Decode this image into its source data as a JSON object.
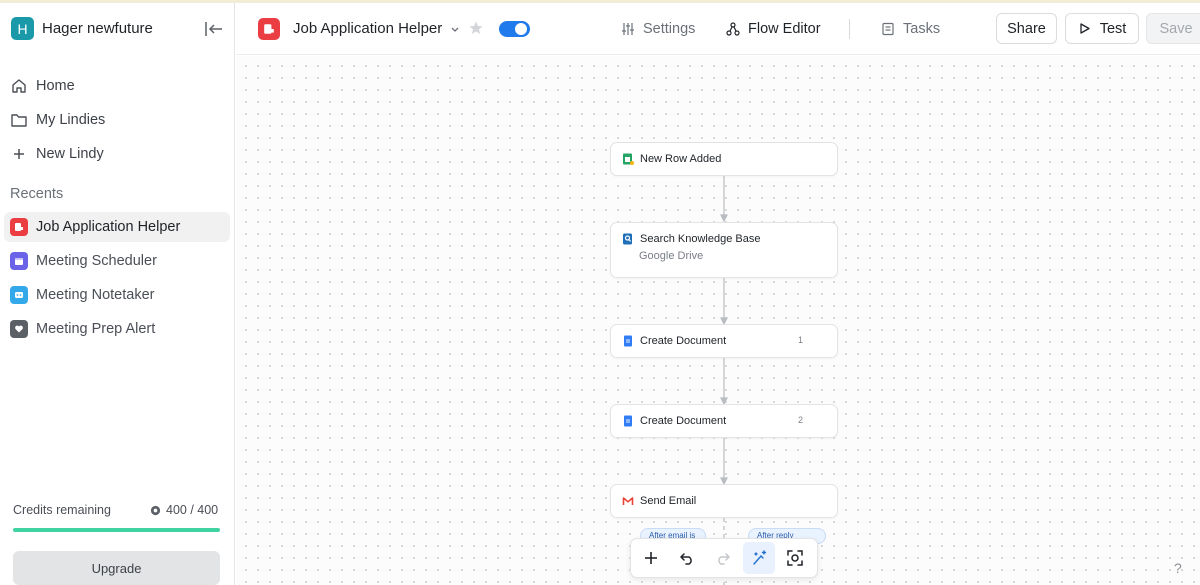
{
  "workspace": {
    "initial": "H",
    "name": "Hager newfuture"
  },
  "nav": [
    {
      "label": "Home",
      "icon": "home-icon"
    },
    {
      "label": "My Lindies",
      "icon": "folder-icon"
    },
    {
      "label": "New Lindy",
      "icon": "plus-icon"
    }
  ],
  "recents": {
    "title": "Recents",
    "items": [
      {
        "label": "Job Application Helper",
        "color": "#ea3e43",
        "active": true
      },
      {
        "label": "Meeting Scheduler",
        "color": "#6a63e8",
        "active": false
      },
      {
        "label": "Meeting Notetaker",
        "color": "#33a9ea",
        "active": false
      },
      {
        "label": "Meeting Prep Alert",
        "color": "#5b5f66",
        "active": false
      }
    ]
  },
  "credits": {
    "label": "Credits remaining",
    "value": "400 / 400",
    "fraction": 1.0,
    "color": "#3fd3a2"
  },
  "upgrade_label": "Upgrade",
  "header": {
    "title": "Job Application Helper",
    "toggle_on": true,
    "tabs": [
      {
        "label": "Settings",
        "icon": "sliders-icon",
        "selected": false
      },
      {
        "label": "Flow Editor",
        "icon": "flow-icon",
        "selected": true
      },
      {
        "label": "Tasks",
        "icon": "tasks-icon",
        "selected": false
      }
    ],
    "share_label": "Share",
    "test_label": "Test",
    "save_label": "Save"
  },
  "flow": {
    "nodes": [
      {
        "label": "New Row Added",
        "icon": "google-sheets-icon"
      },
      {
        "label": "Search Knowledge Base",
        "sub": "Google Drive",
        "icon": "knowledge-base-icon"
      },
      {
        "label": "Create Document",
        "badge": "1",
        "icon": "google-docs-icon"
      },
      {
        "label": "Create Document",
        "badge": "2",
        "icon": "google-docs-icon"
      },
      {
        "label": "Send Email",
        "icon": "gmail-icon"
      }
    ],
    "chips": [
      "After email is sent",
      "After reply received"
    ]
  },
  "toolbar": [
    "add-icon",
    "undo-icon",
    "redo-icon",
    "magic-tidy-icon",
    "focus-icon"
  ],
  "help_label": "?"
}
